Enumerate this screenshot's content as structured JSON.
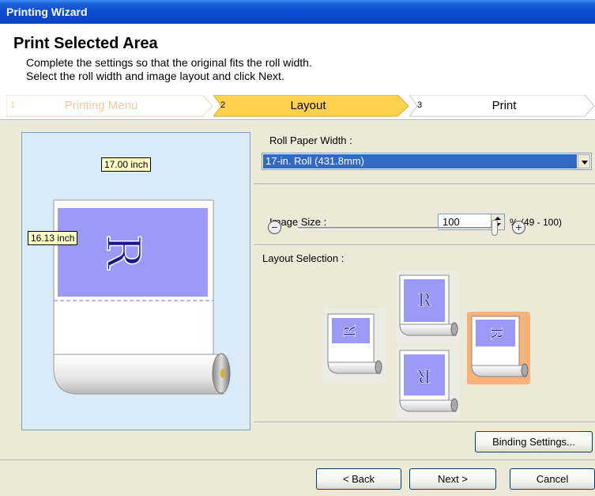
{
  "window": {
    "title": "Printing Wizard"
  },
  "header": {
    "title": "Print Selected Area",
    "description_line1": "Complete the settings so that the original fits the roll width.",
    "description_line2": "Select the roll width and image layout and click Next."
  },
  "steps": [
    {
      "number": "1",
      "label": "Printing Menu",
      "state": "done"
    },
    {
      "number": "2",
      "label": "Layout",
      "state": "current"
    },
    {
      "number": "3",
      "label": "Print",
      "state": "upcoming"
    }
  ],
  "preview": {
    "width_label": "17.00 inch",
    "height_label": "16.13 inch",
    "glyph": "R"
  },
  "roll_paper": {
    "label": "Roll Paper Width :",
    "selected": "17-in. Roll (431.8mm)"
  },
  "image_size": {
    "label": "Image Size :",
    "value": "100",
    "range": "% (49 - 100)",
    "slider_fraction": 1.0
  },
  "layout_selection": {
    "label": "Layout Selection :",
    "options": [
      {
        "glyph": "R",
        "orientation": "rotated-left"
      },
      {
        "glyph": "R",
        "orientation": "upright"
      },
      {
        "glyph": "R",
        "orientation": "upside-down"
      },
      {
        "glyph": "R",
        "orientation": "rotated-right",
        "selected": true
      }
    ]
  },
  "buttons": {
    "binding": "Binding Settings...",
    "back": "< Back",
    "next": "Next >",
    "cancel": "Cancel"
  },
  "colors": {
    "titlebar": "#0b4bd0",
    "step_current": "#ffd24d",
    "image_fill": "#9b9bf7",
    "selection_highlight": "#f7b27c",
    "listbox_selection": "#316ac5"
  }
}
